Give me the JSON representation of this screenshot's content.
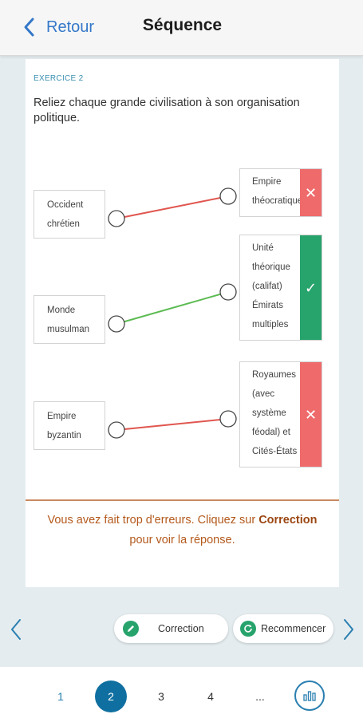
{
  "header": {
    "back_label": "Retour",
    "title": "Séquence"
  },
  "exercise": {
    "label": "EXERCICE 2",
    "question": "Reliez chaque grande civilisation à son organisation politique.",
    "left_items": [
      "Occident chrétien",
      "Monde musulman",
      "Empire byzantin"
    ],
    "right_items": [
      {
        "text": "Empire théocratique",
        "result": "wrong",
        "result_icon": "cross-icon"
      },
      {
        "text": "Unité théorique (califat) Émirats multiples",
        "result": "correct",
        "result_icon": "check-icon"
      },
      {
        "text": "Royaumes (avec système féodal) et Cités-États",
        "result": "wrong",
        "result_icon": "cross-icon"
      }
    ],
    "feedback_pre": "Vous avez fait trop d'erreurs. Cliquez sur ",
    "feedback_strong": "Correction",
    "feedback_post": " pour voir la réponse."
  },
  "actions": {
    "correction_label": "Correction",
    "retry_label": "Recommencer"
  },
  "pagination": {
    "pages": [
      "1",
      "2",
      "3",
      "4",
      "..."
    ],
    "current": "2"
  },
  "colors": {
    "accent_blue": "#3478c9",
    "wrong": "#ef6a6b",
    "correct": "#27a36c",
    "feedback": "#b4591c",
    "active_page": "#0f6fa0"
  }
}
